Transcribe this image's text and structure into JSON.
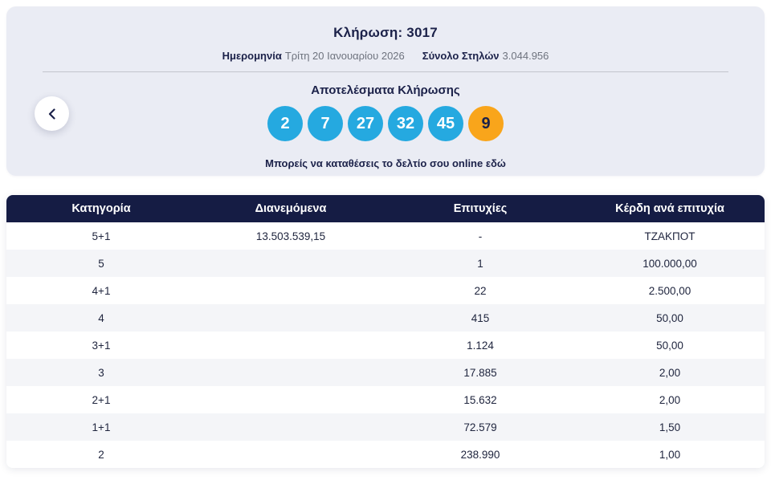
{
  "draw": {
    "title": "Κλήρωση: 3017",
    "date_label": "Ημερομηνία",
    "date_value": "Τρίτη 20 Ιανουαρίου 2026",
    "columns_label": "Σύνολο Στηλών",
    "columns_value": "3.044.956",
    "results_title": "Αποτελέσματα Κλήρωσης",
    "numbers": [
      "2",
      "7",
      "27",
      "32",
      "45"
    ],
    "bonus": "9",
    "note": "Μπορείς να καταθέσεις το δελτίο σου online εδώ"
  },
  "colors": {
    "number_ball": "#25a9e0",
    "bonus_ball": "#f9a51b",
    "table_header_bg": "#151c44",
    "card_bg": "#eaecf4",
    "row_alt_bg": "#f4f5f8"
  },
  "table": {
    "headers": [
      "Κατηγορία",
      "Διανεμόμενα",
      "Επιτυχίες",
      "Κέρδη ανά επιτυχία"
    ],
    "rows": [
      [
        "5+1",
        "13.503.539,15",
        "-",
        "ΤΖΑΚΠΟΤ"
      ],
      [
        "5",
        "",
        "1",
        "100.000,00"
      ],
      [
        "4+1",
        "",
        "22",
        "2.500,00"
      ],
      [
        "4",
        "",
        "415",
        "50,00"
      ],
      [
        "3+1",
        "",
        "1.124",
        "50,00"
      ],
      [
        "3",
        "",
        "17.885",
        "2,00"
      ],
      [
        "2+1",
        "",
        "15.632",
        "2,00"
      ],
      [
        "1+1",
        "",
        "72.579",
        "1,50"
      ],
      [
        "2",
        "",
        "238.990",
        "1,00"
      ]
    ]
  }
}
